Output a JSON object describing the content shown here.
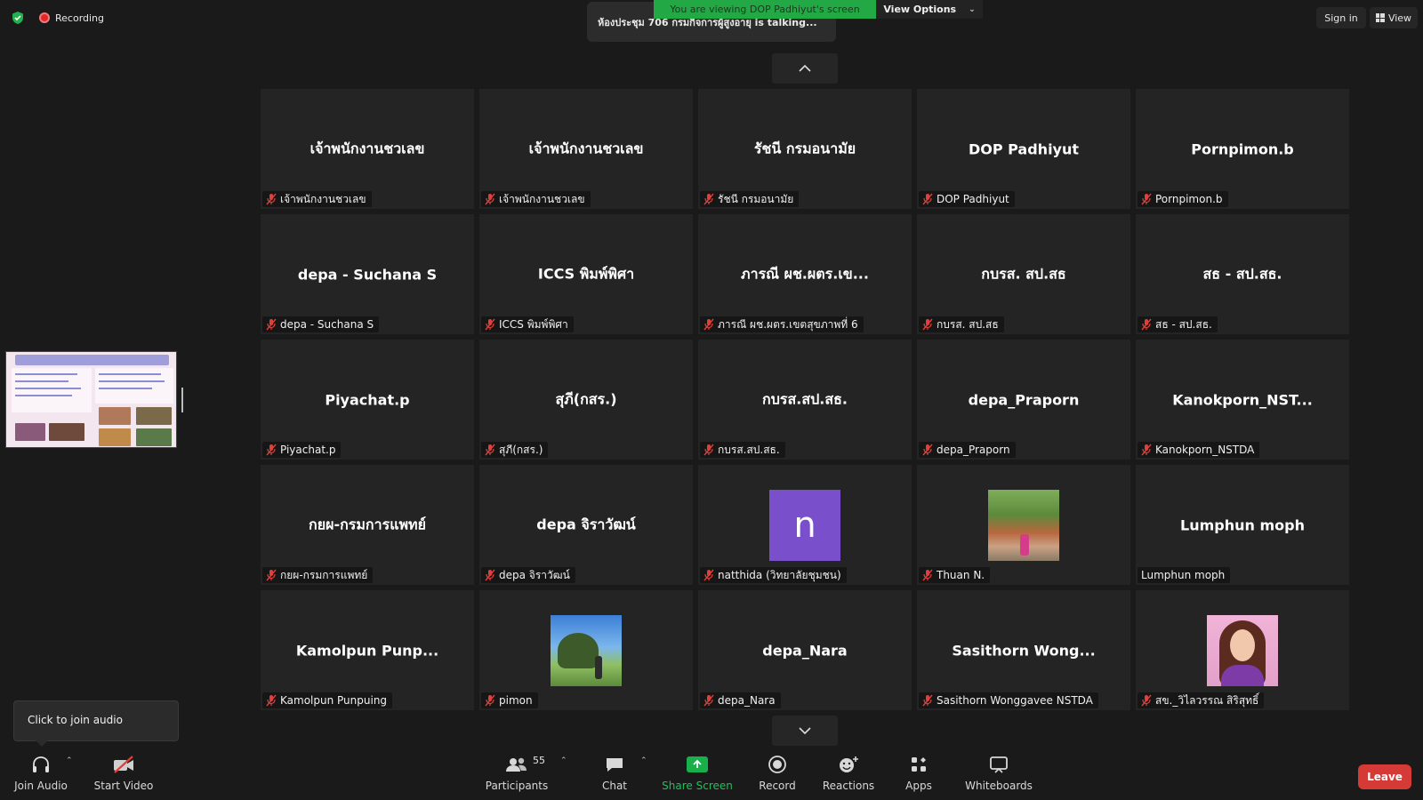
{
  "top": {
    "recording_label": "Recording",
    "viewing_banner": "You are viewing DOP Padhiyut's screen",
    "view_options_label": "View Options",
    "talking_text": "ห้องประชุม 706 กรมกิจการผู้สูงอายุ is talking...",
    "sign_in_label": "Sign in",
    "view_label": "View"
  },
  "participants_grid": [
    {
      "display": "เจ้าพนักงานชวเลข",
      "label": "เจ้าพนักงานชวเลข",
      "muted": true
    },
    {
      "display": "เจ้าพนักงานชวเลข",
      "label": "เจ้าพนักงานชวเลข",
      "muted": true
    },
    {
      "display": "รัชนี กรมอนามัย",
      "label": "รัชนี กรมอนามัย",
      "muted": true
    },
    {
      "display": "DOP Padhiyut",
      "label": "DOP Padhiyut",
      "muted": true
    },
    {
      "display": "Pornpimon.b",
      "label": "Pornpimon.b",
      "muted": true
    },
    {
      "display": "depa - Suchana S",
      "label": "depa - Suchana S",
      "muted": true
    },
    {
      "display": "ICCS พิมพ์พิศา",
      "label": "ICCS พิมพ์พิศา",
      "muted": true
    },
    {
      "display": "ภารณี ผช.ผตร.เข...",
      "label": "ภารณี ผช.ผตร.เขตสุขภาพที่ 6",
      "muted": true
    },
    {
      "display": "กบรส. สป.สธ",
      "label": "กบรส. สป.สธ",
      "muted": true
    },
    {
      "display": "สธ - สป.สธ.",
      "label": "สธ - สป.สธ.",
      "muted": true
    },
    {
      "display": "Piyachat.p",
      "label": "Piyachat.p",
      "muted": true
    },
    {
      "display": "สุภี(กสร.)",
      "label": "สุภี(กสร.)",
      "muted": true
    },
    {
      "display": "กบรส.สป.สธ.",
      "label": "กบรส.สป.สธ.",
      "muted": true
    },
    {
      "display": "depa_Praporn",
      "label": "depa_Praporn",
      "muted": true
    },
    {
      "display": "Kanokporn_NST...",
      "label": "Kanokporn_NSTDA",
      "muted": true
    },
    {
      "display": "กยผ-กรมการแพทย์",
      "label": "กยผ-กรมการแพทย์",
      "muted": true
    },
    {
      "display": "depa จิราวัฒน์",
      "label": "depa จิราวัฒน์",
      "muted": true
    },
    {
      "display": "",
      "label": "natthida (วิทยาลัยชุมชน)",
      "muted": true,
      "avatar": "letter",
      "avatar_letter": "n"
    },
    {
      "display": "",
      "label": "Thuan N.",
      "muted": true,
      "avatar": "landscape"
    },
    {
      "display": "Lumphun moph",
      "label": "Lumphun moph",
      "muted": false
    },
    {
      "display": "Kamolpun Punp...",
      "label": "Kamolpun Punpuing",
      "muted": true
    },
    {
      "display": "",
      "label": "pimon",
      "muted": true,
      "avatar": "sky"
    },
    {
      "display": "depa_Nara",
      "label": "depa_Nara",
      "muted": true
    },
    {
      "display": "Sasithorn Wong...",
      "label": "Sasithorn Wonggavee NSTDA",
      "muted": true
    },
    {
      "display": "",
      "label": "สข._วิไลวรรณ สิริสุทธิ์",
      "muted": true,
      "avatar": "portrait"
    }
  ],
  "join_tooltip": "Click to join audio",
  "toolbar": {
    "join_audio": "Join Audio",
    "start_video": "Start Video",
    "participants": "Participants",
    "participants_count": "55",
    "chat": "Chat",
    "share_screen": "Share Screen",
    "record": "Record",
    "reactions": "Reactions",
    "apps": "Apps",
    "whiteboards": "Whiteboards",
    "leave": "Leave"
  },
  "colors": {
    "background": "#1a1a1a",
    "tile": "#242424",
    "banner_green": "#22a845",
    "share_green": "#19b04c",
    "leave_red": "#d63a36",
    "mute_red": "#e0403a"
  }
}
